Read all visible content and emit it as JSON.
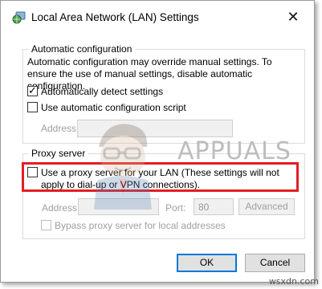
{
  "window": {
    "title": "Local Area Network (LAN) Settings",
    "close_glyph": "✕"
  },
  "auto_config": {
    "group_label": "Automatic configuration",
    "description": "Automatic configuration may override manual settings.  To ensure the use of manual settings, disable automatic configuration.",
    "auto_detect": {
      "label": "Automatically detect settings",
      "checked": true
    },
    "auto_script": {
      "label": "Use automatic configuration script",
      "checked": false
    },
    "address_label": "Address",
    "address_value": ""
  },
  "proxy": {
    "group_label": "Proxy server",
    "use_proxy": {
      "label": "Use a proxy server for your LAN (These settings will not apply to dial-up or VPN connections).",
      "checked": false
    },
    "address_label": "Address:",
    "address_value": "",
    "port_label": "Port:",
    "port_value": "80",
    "advanced_label": "Advanced",
    "bypass": {
      "label": "Bypass proxy server for local addresses",
      "checked": false
    }
  },
  "buttons": {
    "ok": "OK",
    "cancel": "Cancel"
  },
  "watermark": {
    "text": "APPUALS",
    "site": "wsxdn.com"
  },
  "colors": {
    "highlight": "#e31e24",
    "focus": "#0078d7"
  },
  "icons": {
    "title": "network-globe-icon",
    "mascot": "appuals-mascot-icon"
  }
}
